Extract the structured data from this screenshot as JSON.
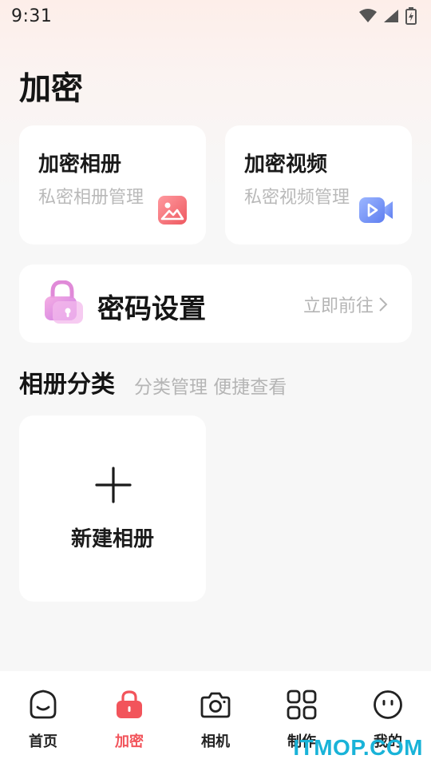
{
  "status_bar": {
    "time": "9:31"
  },
  "page": {
    "title": "加密"
  },
  "cards": [
    {
      "title": "加密相册",
      "subtitle": "私密相册管理",
      "icon": "picture-icon",
      "color": "#f06b73"
    },
    {
      "title": "加密视频",
      "subtitle": "私密视频管理",
      "icon": "video-camera-icon",
      "color": "#6e8df4"
    }
  ],
  "password_card": {
    "title": "密码设置",
    "action": "立即前往",
    "icon": "lock-icon"
  },
  "section": {
    "title": "相册分类",
    "subtitle": "分类管理 便捷查看"
  },
  "new_album": {
    "label": "新建相册"
  },
  "tabs": [
    {
      "label": "首页",
      "icon": "home-face-icon"
    },
    {
      "label": "加密",
      "icon": "lock-icon",
      "active": true
    },
    {
      "label": "相机",
      "icon": "camera-icon"
    },
    {
      "label": "制作",
      "icon": "grid-icon"
    },
    {
      "label": "我的",
      "icon": "smiley-icon"
    }
  ],
  "colors": {
    "accent": "#f2545b",
    "subtitle_gray": "#b9b9b9",
    "watermark": "#19b3d8"
  },
  "watermark": "ITMOP.COM"
}
